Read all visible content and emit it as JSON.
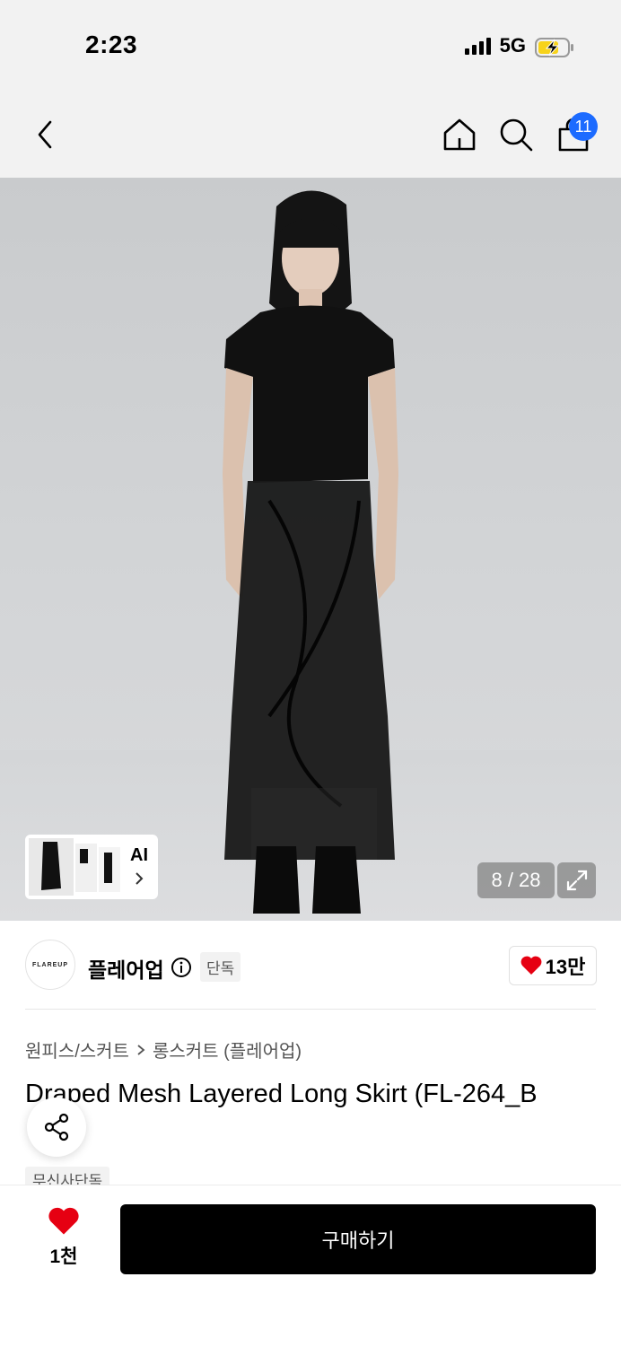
{
  "status_bar": {
    "time": "2:23",
    "network": "5G"
  },
  "nav": {
    "cart_badge": "11"
  },
  "gallery": {
    "counter": "8 / 28",
    "ai_label": "AI"
  },
  "brand": {
    "logo_text": "FLAREUP",
    "name": "플레어업",
    "tag": "단독",
    "likes": "13만"
  },
  "breadcrumb": {
    "category": "원피스/스커트",
    "subcategory": "롱스커트 (플레어업)"
  },
  "product": {
    "title": "Draped Mesh Layered Long Skirt (FL-264_B",
    "tag": "무신사단독"
  },
  "bottom_bar": {
    "wish_count": "1천",
    "buy_label": "구매하기"
  },
  "colors": {
    "accent_blue": "#1c6bff",
    "heart_red": "#e60012",
    "buy_button": "#000000"
  }
}
